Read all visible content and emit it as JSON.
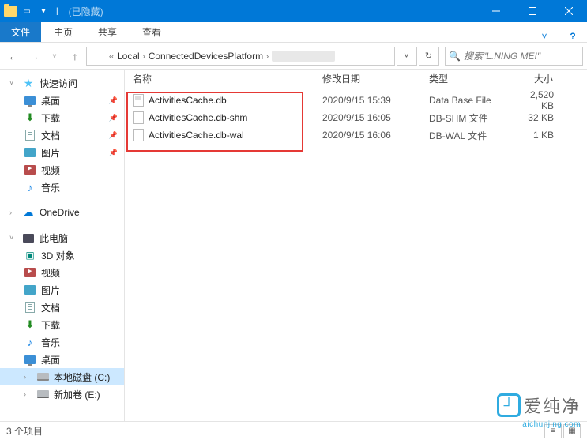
{
  "titlebar": {
    "title": "(已隐藏)"
  },
  "ribbon": {
    "file": "文件",
    "tabs": [
      "主页",
      "共享",
      "查看"
    ]
  },
  "breadcrumb": {
    "seg1": "Local",
    "seg2": "ConnectedDevicesPlatform",
    "seg3_obscured": "████████"
  },
  "search": {
    "placeholder": "搜索\"L.NING MEI\""
  },
  "columns": {
    "name": "名称",
    "date": "修改日期",
    "type": "类型",
    "size": "大小"
  },
  "files": [
    {
      "name": "ActivitiesCache.db",
      "date": "2020/9/15 15:39",
      "type": "Data Base File",
      "size": "2,520 KB",
      "ico": "db"
    },
    {
      "name": "ActivitiesCache.db-shm",
      "date": "2020/9/15 16:05",
      "type": "DB-SHM 文件",
      "size": "32 KB",
      "ico": ""
    },
    {
      "name": "ActivitiesCache.db-wal",
      "date": "2020/9/15 16:06",
      "type": "DB-WAL 文件",
      "size": "1 KB",
      "ico": ""
    }
  ],
  "sidebar": {
    "quickaccess": "快速访问",
    "desktop": "桌面",
    "downloads": "下载",
    "documents": "文档",
    "pictures": "图片",
    "videos": "视频",
    "music": "音乐",
    "onedrive": "OneDrive",
    "thispc": "此电脑",
    "objects3d": "3D 对象",
    "localdisk": "本地磁盘 (C:)",
    "newvolume": "新加卷 (E:)"
  },
  "status": {
    "count": "3 个项目"
  },
  "watermark": {
    "brand": "爱纯净",
    "url": "aichunjing.com"
  }
}
